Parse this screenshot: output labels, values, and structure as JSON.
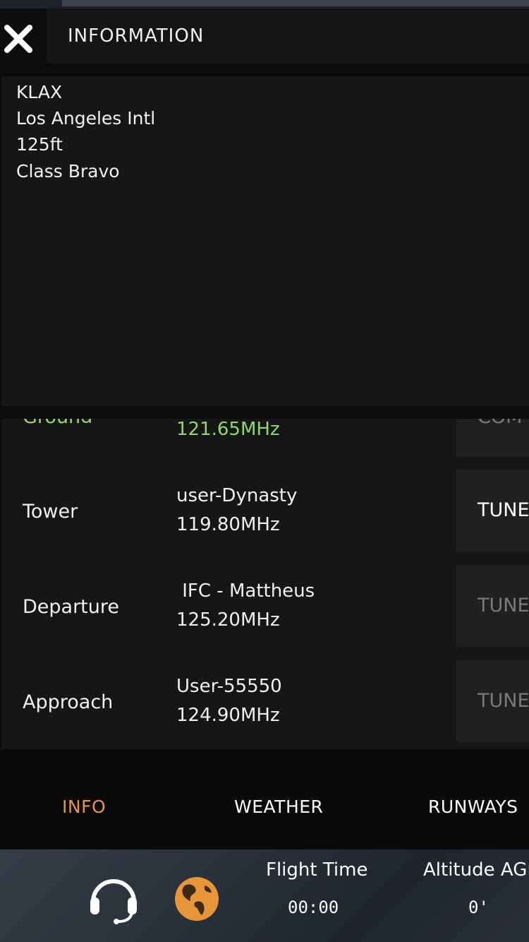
{
  "header": {
    "title": "INFORMATION"
  },
  "airport": {
    "lines": [
      "KLAX",
      "Los Angeles Intl",
      "125ft",
      "Class Bravo"
    ]
  },
  "frequencies": {
    "partial_top": {
      "name": "Ground",
      "frequency": "121.65MHz",
      "button": "COM"
    },
    "rows": [
      {
        "name": "Tower",
        "operator": "user-Dynasty",
        "frequency": "119.80MHz",
        "button": "TUNE",
        "enabled": true
      },
      {
        "name": "Departure",
        "operator": " IFC - Mattheus",
        "frequency": "125.20MHz",
        "button": "TUNE",
        "enabled": false
      },
      {
        "name": "Approach",
        "operator": "User-55550",
        "frequency": "124.90MHz",
        "button": "TUNE",
        "enabled": false
      }
    ]
  },
  "tabs": [
    {
      "label": "INFO",
      "active": true
    },
    {
      "label": "WEATHER",
      "active": false
    },
    {
      "label": "RUNWAYS",
      "active": false
    }
  ],
  "status_bar": {
    "icons": [
      "headset-icon",
      "globe-icon"
    ],
    "flight_time_label": "Flight Time",
    "flight_time_value": "00:00",
    "altitude_label": "Altitude AGL",
    "altitude_value": "0'"
  },
  "colors": {
    "accent_orange": "#e8953a",
    "ground_green": "#8fd86a",
    "disabled_text": "#7a7a7a"
  }
}
